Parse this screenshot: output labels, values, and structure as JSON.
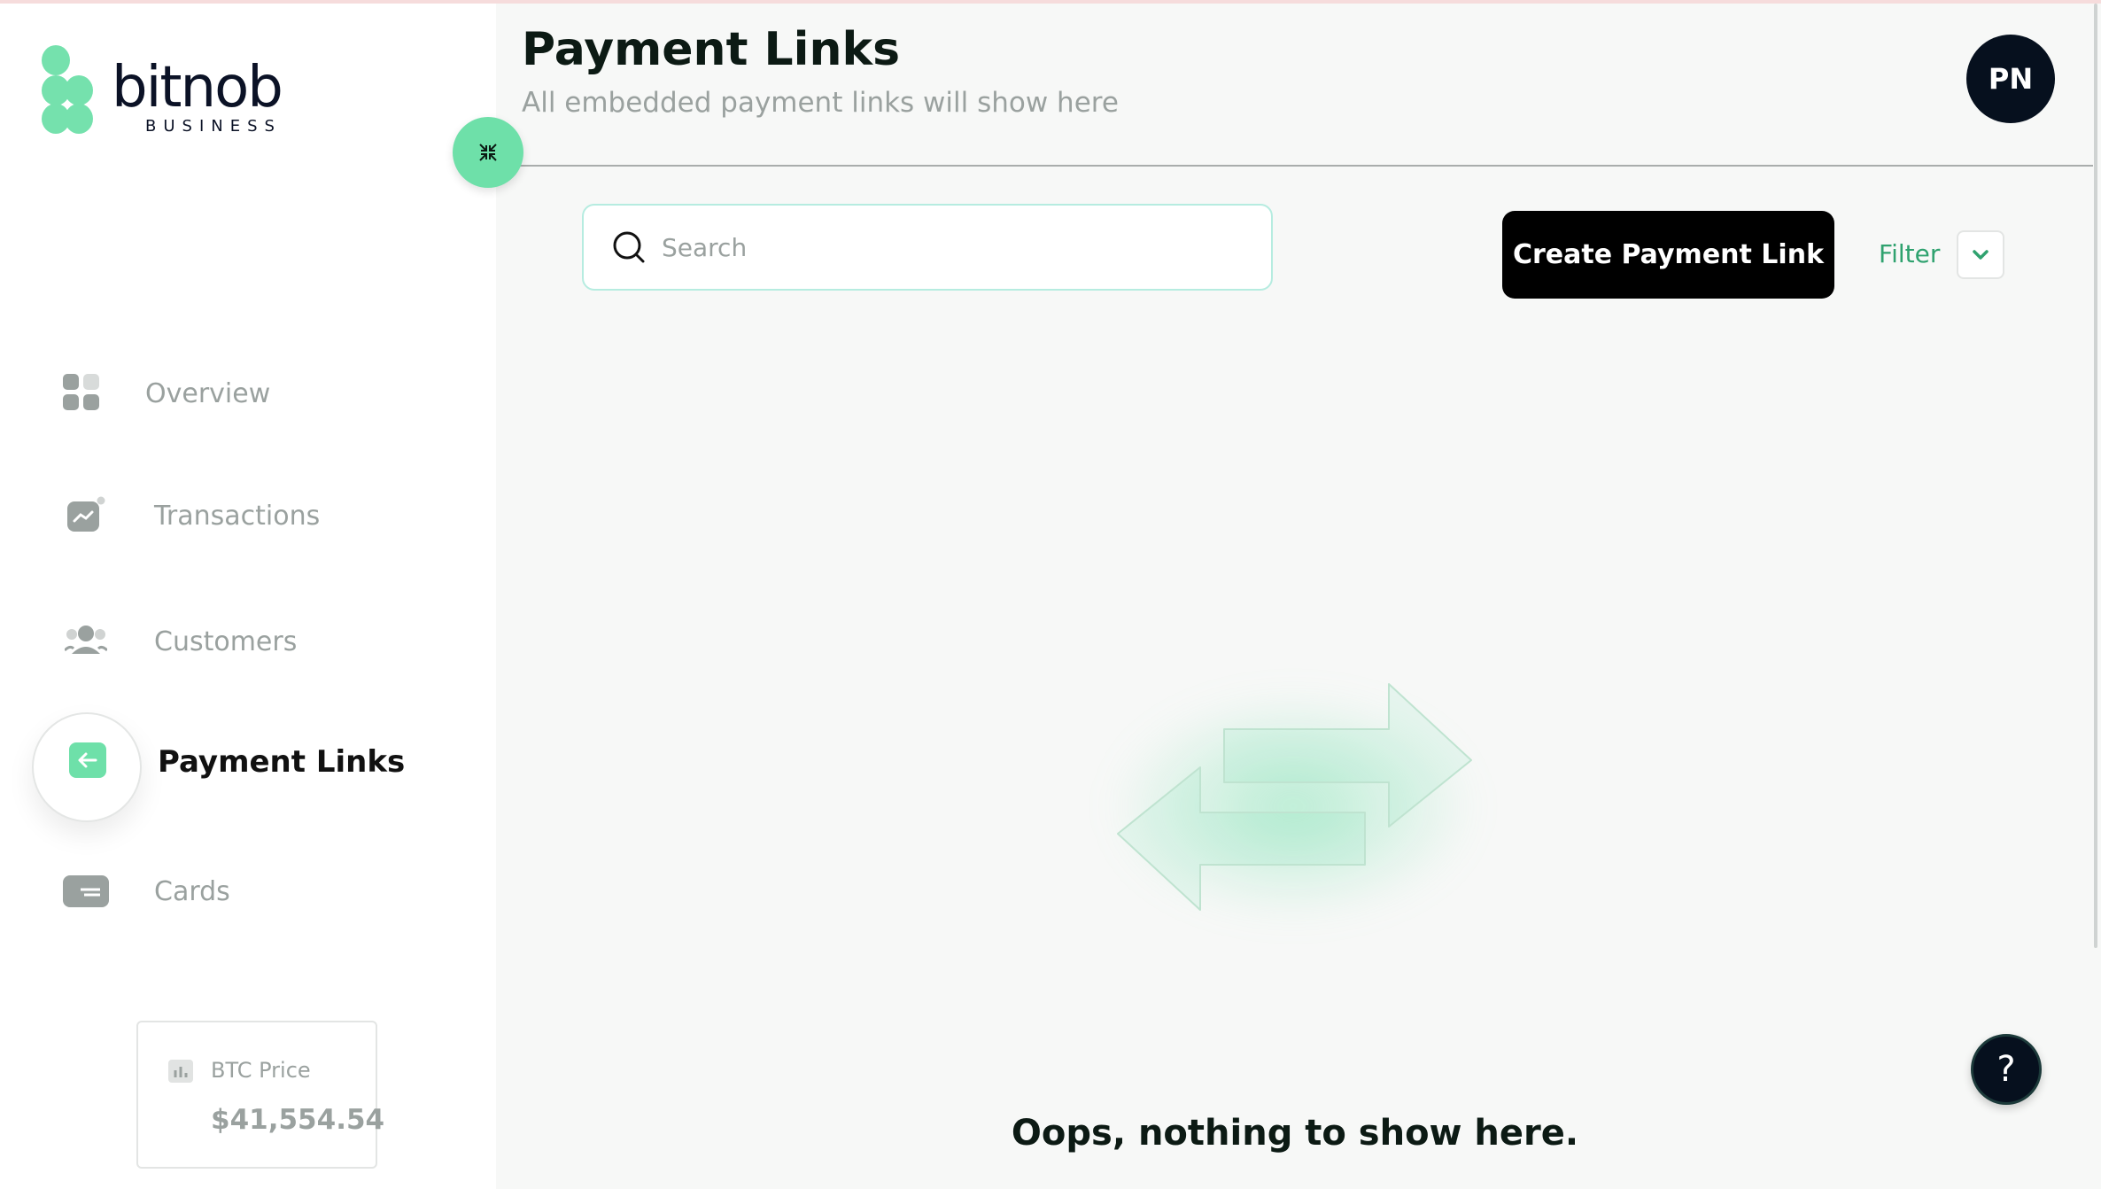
{
  "brand": {
    "name": "bitnob",
    "sub": "BUSINESS",
    "color": "#6ee0a9"
  },
  "sidebar": {
    "items": [
      {
        "label": "Overview",
        "icon": "grid-icon"
      },
      {
        "label": "Transactions",
        "icon": "chart-line-icon"
      },
      {
        "label": "Customers",
        "icon": "users-icon"
      },
      {
        "label": "Payment Links",
        "icon": "arrow-left-icon",
        "active": true
      },
      {
        "label": "Cards",
        "icon": "card-icon"
      }
    ],
    "btc": {
      "label": "BTC Price",
      "value": "$41,554.54"
    }
  },
  "header": {
    "title": "Payment Links",
    "subtitle": "All embedded payment links will show here",
    "avatar": "PN"
  },
  "toolbar": {
    "search_placeholder": "Search",
    "create_label": "Create Payment Link",
    "filter_label": "Filter"
  },
  "empty": {
    "message": "Oops, nothing to show here."
  },
  "help": {
    "label": "?"
  }
}
